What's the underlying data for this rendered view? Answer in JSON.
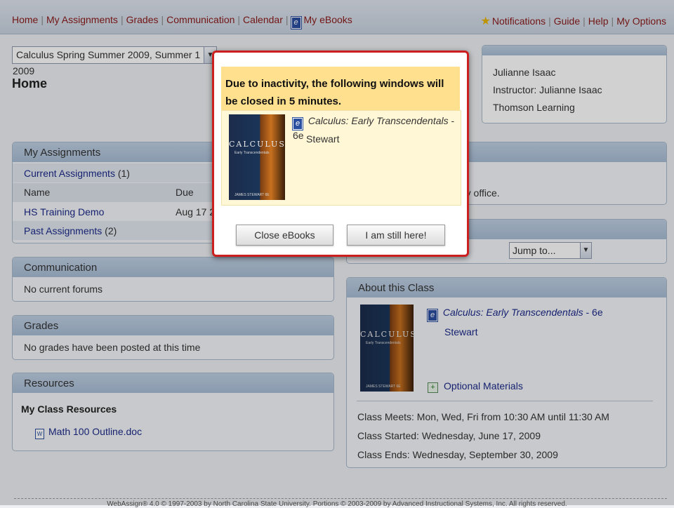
{
  "nav": {
    "left": [
      "Home",
      "My Assignments",
      "Grades",
      "Communication",
      "Calendar",
      "My eBooks"
    ],
    "right": [
      "Notifications",
      "Guide",
      "Help",
      "My Options"
    ]
  },
  "class_select": "Calculus Spring Summer 2009, Summer 1 2009",
  "page_title": "Home",
  "user": {
    "name": "Julianne Isaac",
    "instructor": "Instructor: Julianne Isaac",
    "school": "Thomson Learning"
  },
  "my_assignments": {
    "title": "My Assignments",
    "current_label": "Current Assignments",
    "current_count": "(1)",
    "col_name": "Name",
    "col_due": "Due",
    "rows": [
      {
        "name": "HS Training Demo",
        "due": "Aug 17 2"
      }
    ],
    "past_label": "Past Assignments",
    "past_count": "(2)"
  },
  "partial_text": "my office.",
  "communication": {
    "title": "Communication",
    "text": "No current forums"
  },
  "grades": {
    "title": "Grades",
    "text": "No grades have been posted at this time"
  },
  "resources": {
    "title": "Resources",
    "subtitle": "My Class Resources",
    "file": "Math 100 Outline.doc"
  },
  "jump_to": "Jump to...",
  "about": {
    "title": "About this Class",
    "book_title": "Calculus: Early Transcendentals",
    "book_edition": " - 6e",
    "book_author": "Stewart",
    "optional": "Optional Materials",
    "meets": "Class Meets: Mon, Wed, Fri from 10:30 AM until 11:30 AM",
    "started": "Class Started: Wednesday, June 17, 2009",
    "ends": "Class Ends: Wednesday, September 30, 2009"
  },
  "cover": {
    "title": "CALCULUS",
    "subtitle": "Early Transcendentals",
    "author": "JAMES STEWART  6E"
  },
  "modal": {
    "message": "Due to inactivity, the following windows will be closed in 5 minutes.",
    "book_title": "Calculus: Early Transcendentals",
    "book_edition": " - 6e",
    "book_author": "Stewart",
    "btn_close": "Close eBooks",
    "btn_stay": "I am still here!"
  },
  "footer": "WebAssign® 4.0 © 1997-2003 by North Carolina State University. Portions © 2003-2009 by Advanced Instructional Systems, Inc. All rights reserved."
}
